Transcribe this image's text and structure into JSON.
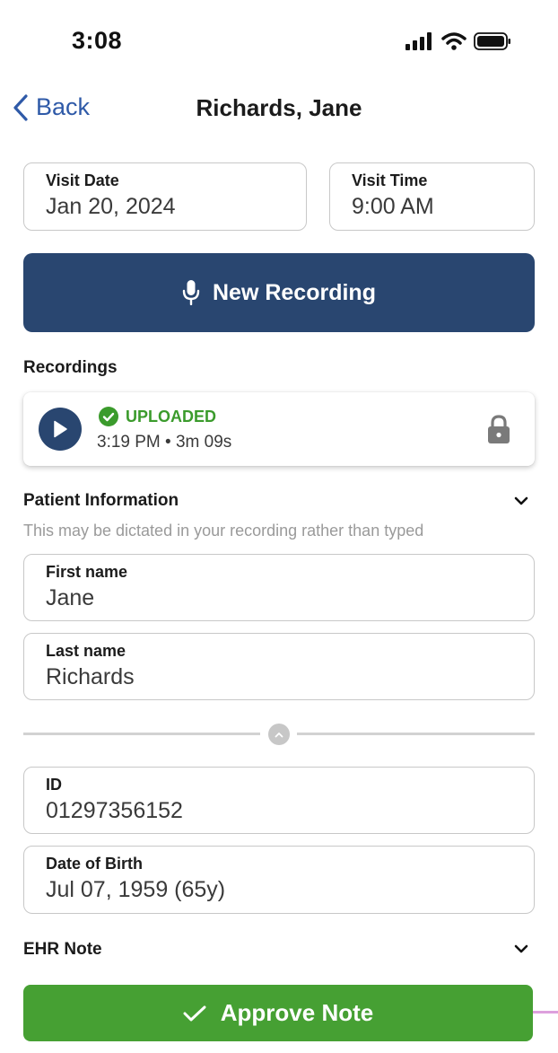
{
  "status_bar": {
    "time": "3:08",
    "icons": [
      "cellular-signal-icon",
      "wifi-icon",
      "battery-icon"
    ]
  },
  "nav": {
    "back_label": "Back",
    "title": "Richards, Jane"
  },
  "visit": {
    "date_label": "Visit Date",
    "date_value": "Jan 20, 2024",
    "time_label": "Visit Time",
    "time_value": "9:00 AM"
  },
  "new_recording": {
    "label": "New Recording",
    "icon": "microphone-icon"
  },
  "recordings": {
    "title": "Recordings",
    "items": [
      {
        "status": "UPLOADED",
        "meta": "3:19 PM • 3m 09s"
      }
    ]
  },
  "patient": {
    "title": "Patient Information",
    "hint": "This may be dictated in your recording rather than typed",
    "first_name_label": "First name",
    "first_name_value": "Jane",
    "last_name_label": "Last name",
    "last_name_value": "Richards",
    "id_label": "ID",
    "id_value": "01297356152",
    "dob_label": "Date of Birth",
    "dob_value": "Jul 07, 1959 (65y)"
  },
  "ehr": {
    "title": "EHR Note"
  },
  "approve": {
    "label": "Approve Note"
  },
  "colors": {
    "primary": "#294670",
    "success": "#46a033",
    "link": "#2f5aa8",
    "status_green": "#3b9b2c"
  }
}
